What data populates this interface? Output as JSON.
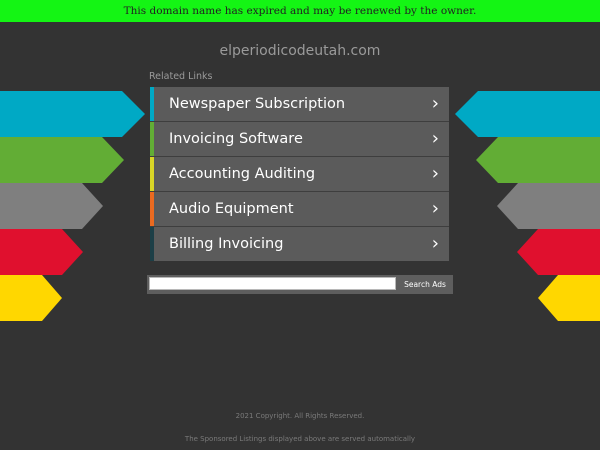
{
  "banner": {
    "text": "This domain name has expired and may be renewed by the owner."
  },
  "domain": "elperiodicodeutah.com",
  "related_links": {
    "title": "Related Links",
    "items": [
      {
        "label": "Newspaper Subscription",
        "accent": "#00a9c5"
      },
      {
        "label": "Invoicing Software",
        "accent": "#62ad35"
      },
      {
        "label": "Accounting Auditing",
        "accent": "#d8d526"
      },
      {
        "label": "Audio Equipment",
        "accent": "#ea6a20"
      },
      {
        "label": "Billing Invoicing",
        "accent": "#1c3f47"
      }
    ]
  },
  "search": {
    "value": "",
    "button_label": "Search Ads"
  },
  "footer": {
    "copyright": "2021 Copyright. All Rights Reserved.",
    "disclaimer": "The Sponsored Listings displayed above are served automatically"
  },
  "colors": {
    "background": "#333333",
    "banner_bg": "#14f514",
    "arrow_colors": [
      "#00a9c5",
      "#62ad35",
      "#7f7f7f",
      "#e0102e",
      "#ffd700"
    ]
  }
}
